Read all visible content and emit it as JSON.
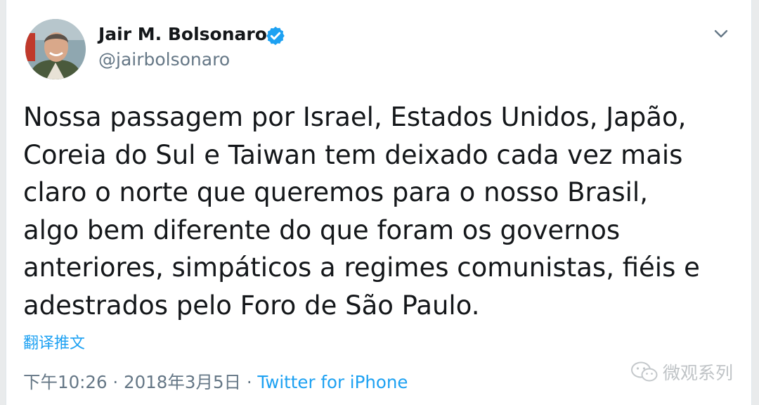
{
  "tweet": {
    "author": {
      "display_name": "Jair M. Bolsonaro",
      "handle": "@jairbolsonaro",
      "verified": true,
      "avatar_icon": "profile-photo"
    },
    "menu_icon": "chevron-down-icon",
    "text_lines": [
      "Nossa passagem por Israel, Estados Unidos, Japão,",
      "Coreia do Sul e Taiwan tem deixado cada vez mais",
      "claro o norte que queremos para o nosso Brasil,",
      "algo bem diferente do que foram os governos",
      "anteriores, simpáticos a regimes comunistas, fiéis e",
      "adestrados pelo Foro de São Paulo."
    ],
    "translate_label": "翻译推文",
    "time": "下午10:26",
    "separator": "·",
    "date": "2018年3月5日",
    "source": "Twitter for iPhone"
  },
  "watermark": {
    "text": "微观系列",
    "icon": "wechat-icon"
  },
  "colors": {
    "link": "#1da1f2",
    "text": "#14171a",
    "secondary": "#657786",
    "verified": "#1da1f2"
  }
}
